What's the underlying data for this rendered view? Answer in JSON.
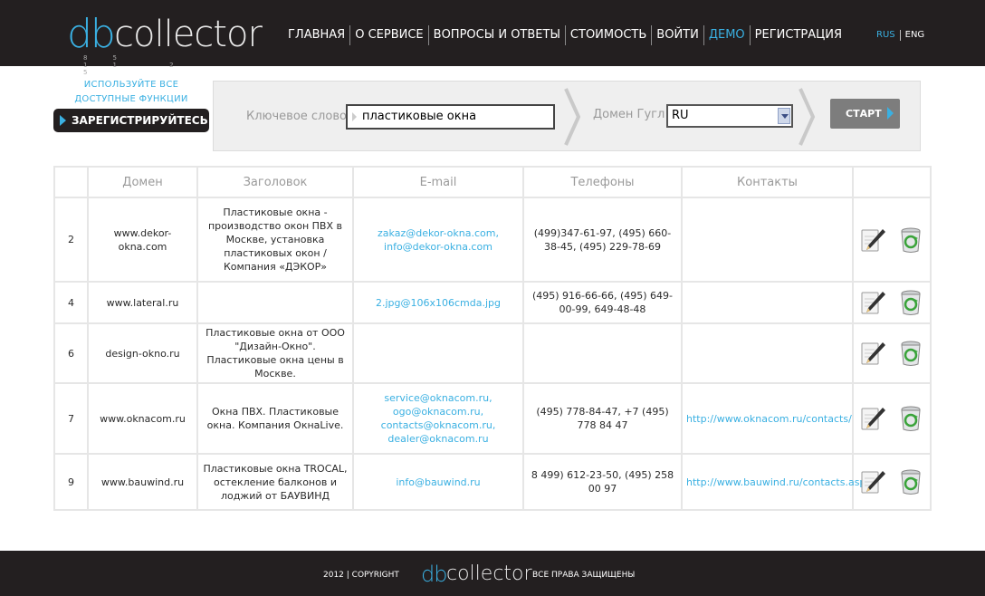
{
  "header": {
    "logo": {
      "part1": "db",
      "part2": "collector",
      "digits": "85 11 2 5"
    },
    "nav": [
      "ГЛАВНАЯ",
      "О СЕРВИСЕ",
      "ВОПРОСЫ И ОТВЕТЫ",
      "СТОИМОСТЬ",
      "ВОЙТИ",
      "ДЕМО",
      "РЕГИСТРАЦИЯ"
    ],
    "active_nav": "ДЕМО",
    "lang": {
      "rus": "RUS",
      "eng": "ENG"
    }
  },
  "promo": {
    "line1": "ИСПОЛЬЗУЙТЕ ВСЕ",
    "line2": "ДОСТУПНЫЕ ФУНКЦИИ",
    "register_label": "ЗАРЕГИСТРИРУЙТЕСЬ!"
  },
  "search": {
    "keyword_label": "Ключевое слово",
    "keyword_value": "пластиковые окна",
    "domain_label": "Домен Гугл",
    "domain_value": "RU",
    "start_label": "СТАРТ"
  },
  "table": {
    "headers": [
      "",
      "Домен",
      "Заголовок",
      "E-mail",
      "Телефоны",
      "Контакты",
      ""
    ],
    "rows": [
      {
        "num": "2",
        "domain": "www.dekor-okna.com",
        "title": "Пластиковые окна - производство окон ПВХ в Москве, установка пластиковых окон / Компания «ДЭКОР»",
        "email": "zakaz@dekor-okna.com, info@dekor-okna.com",
        "phones": "(499)347-61-97, (495) 660-38-45, (495) 229-78-69",
        "contacts": ""
      },
      {
        "num": "4",
        "domain": "www.lateral.ru",
        "title": "",
        "email": "2.jpg@106x106cmda.jpg",
        "phones": "(495) 916-66-66, (495) 649-00-99, 649-48-48",
        "contacts": ""
      },
      {
        "num": "6",
        "domain": "design-okno.ru",
        "title": "Пластиковые окна от ООО \"Дизайн-Окно\". Пластиковые окна цены в Москве.",
        "email": "",
        "phones": "",
        "contacts": ""
      },
      {
        "num": "7",
        "domain": "www.oknacom.ru",
        "title": "Окна ПВХ. Пластиковые окна. Компания ОкнаLive.",
        "email": "service@oknacom.ru, ogo@oknacom.ru, contacts@oknacom.ru, dealer@oknacom.ru",
        "phones": "(495) 778-84-47, +7 (495) 778 84 47",
        "contacts": "http://www.oknacom.ru/contacts/"
      },
      {
        "num": "9",
        "domain": "www.bauwind.ru",
        "title": "Пластиковые окна TROCAL, остекление балконов и лоджий от БАУВИНД",
        "email": "info@bauwind.ru",
        "phones": "8 499) 612-23-50, (495) 258 00 97",
        "contacts": "http://www.bauwind.ru/contacts.asp"
      }
    ]
  },
  "footer": {
    "copyright": "2012 | COPYRIGHT",
    "logo": {
      "part1": "db",
      "part2": "collector"
    },
    "rights": "ВСЕ ПРАВА ЗАЩИЩЕНЫ"
  },
  "colors": {
    "header_bg": "#231f20",
    "accent": "#3ab0e2",
    "panel_bg": "#efefef",
    "button_gray": "#7d7d7d"
  },
  "icons": {
    "edit": "pencil-notepad-icon",
    "delete": "recycle-bin-icon"
  }
}
